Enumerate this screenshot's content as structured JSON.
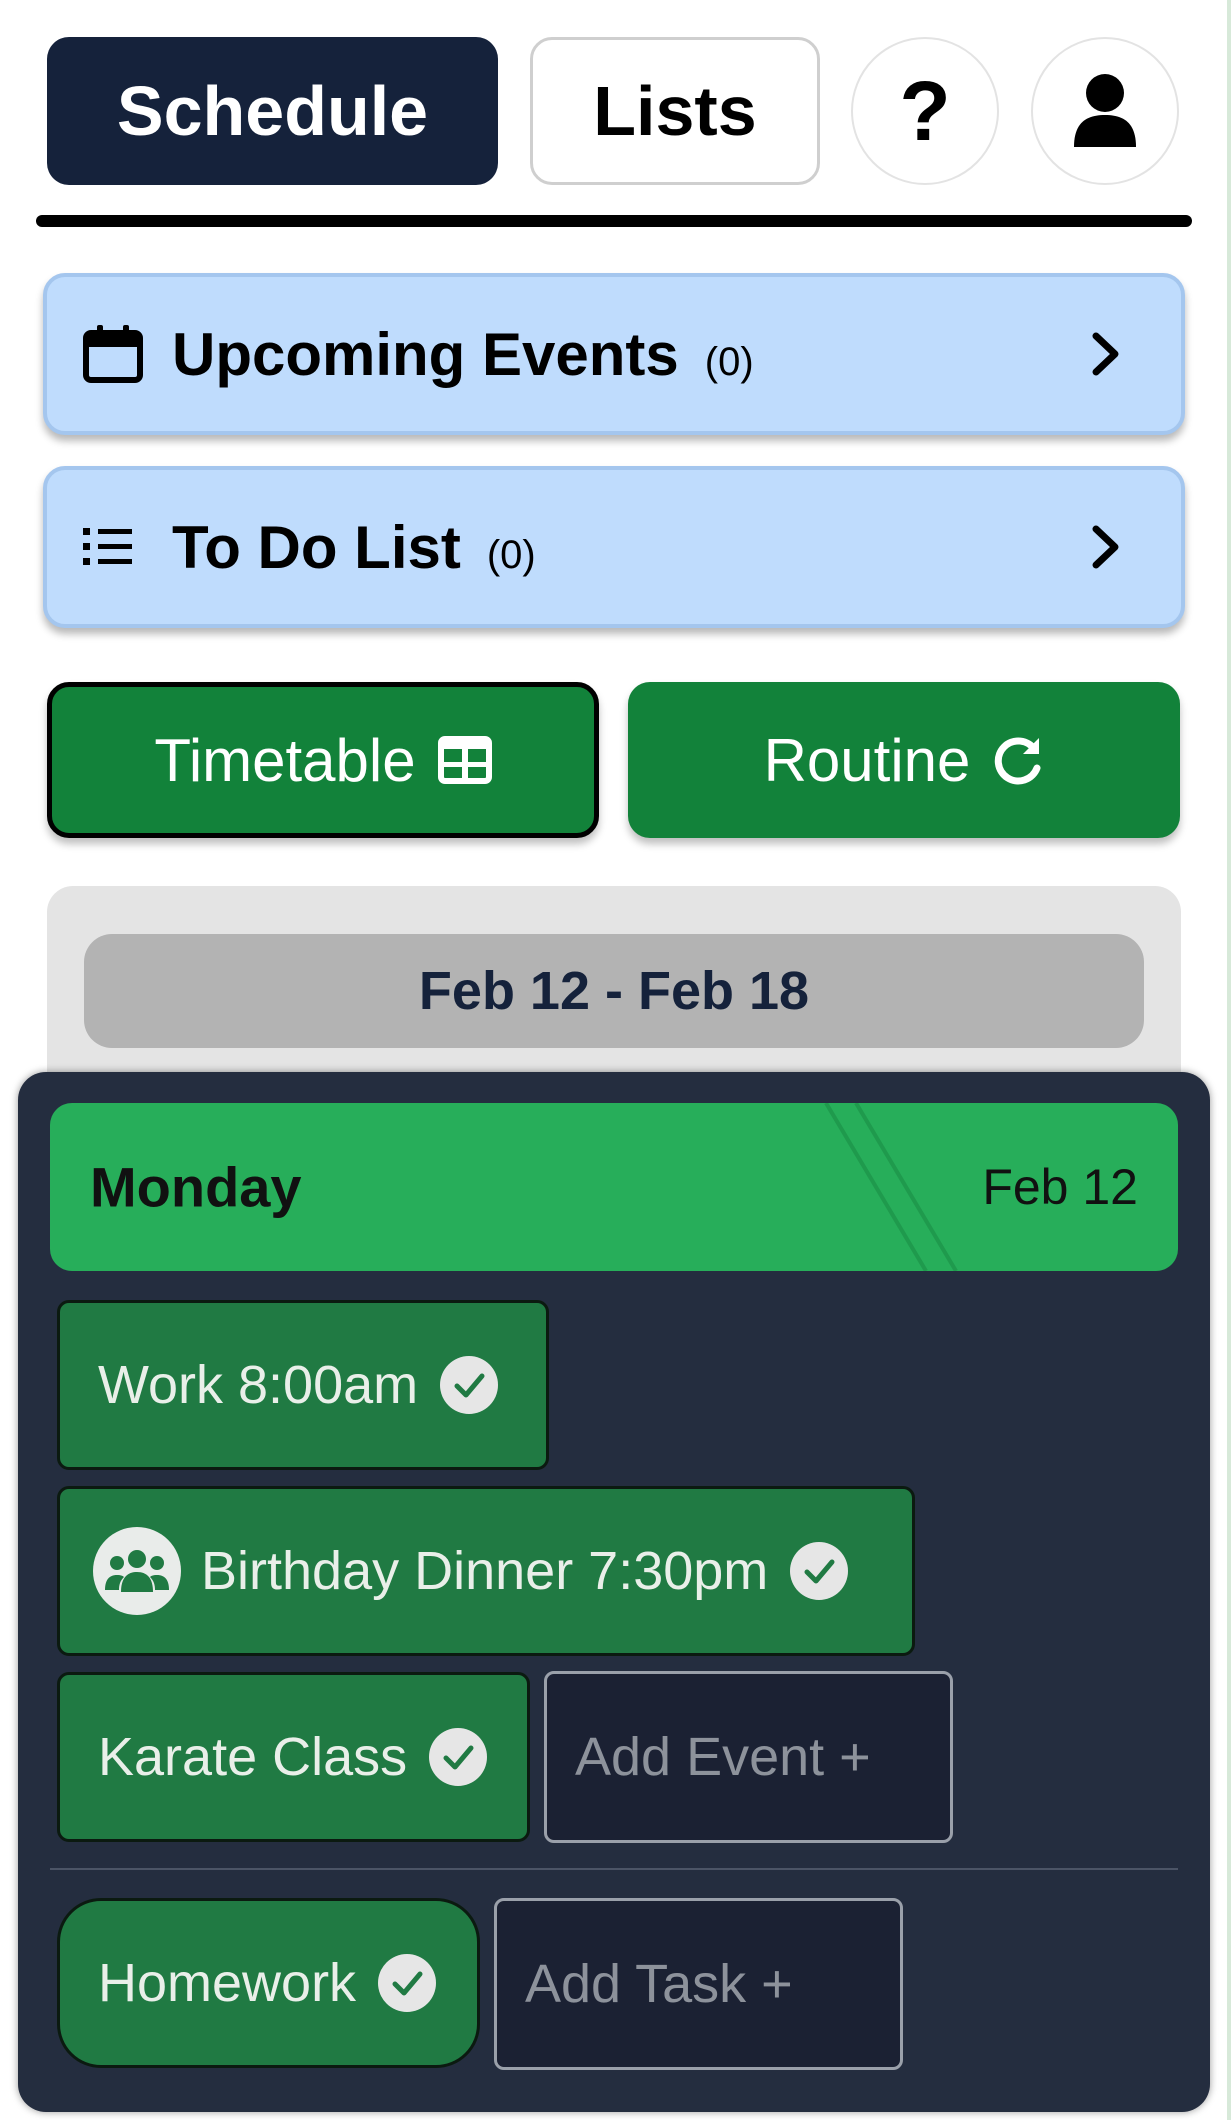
{
  "nav": {
    "schedule_label": "Schedule",
    "lists_label": "Lists",
    "help_label": "?",
    "profile_icon": "user-icon"
  },
  "cards": {
    "upcoming": {
      "icon": "calendar-icon",
      "title": "Upcoming Events",
      "count": "(0)"
    },
    "todo": {
      "icon": "list-icon",
      "title": "To Do List",
      "count": "(0)"
    }
  },
  "actions": {
    "timetable_label": "Timetable",
    "timetable_icon": "table-icon",
    "routine_label": "Routine",
    "routine_icon": "refresh-icon"
  },
  "week": {
    "range": "Feb 12 - Feb 18"
  },
  "day": {
    "name": "Monday",
    "date": "Feb 12",
    "events": [
      {
        "label": "Work 8:00am",
        "done": true
      },
      {
        "label": "Birthday Dinner 7:30pm",
        "done": true,
        "icon": "group-icon"
      },
      {
        "label": "Karate Class",
        "done": true
      }
    ],
    "add_event_label": "Add Event +",
    "tasks": [
      {
        "label": "Homework",
        "done": true
      }
    ],
    "add_task_label": "Add Task +"
  },
  "colors": {
    "nav_active": "#15223b",
    "card_bg": "#bfdcfd",
    "green_button": "#12823a",
    "day_header": "#27ae5a",
    "event_chip": "#207a43",
    "day_panel": "#242d3f"
  }
}
